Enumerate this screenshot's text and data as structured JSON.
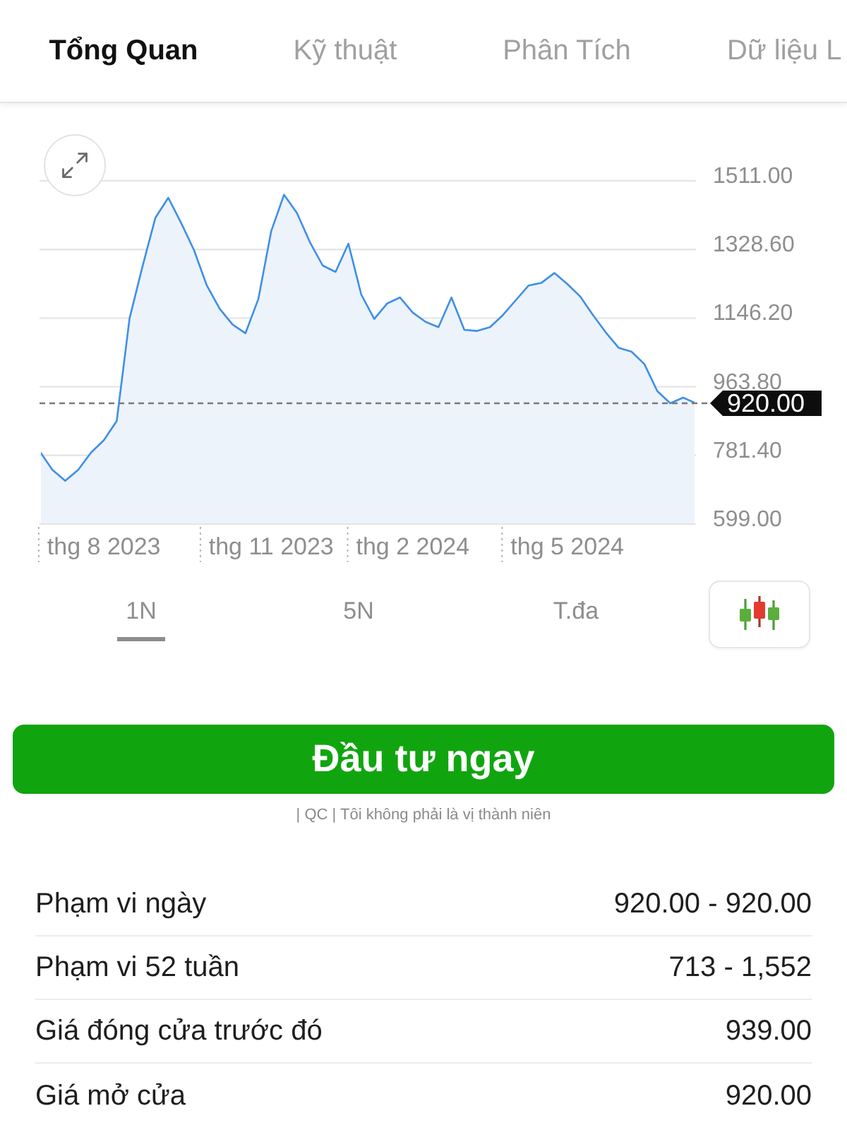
{
  "tabs": [
    {
      "label": "Tổng Quan",
      "selected": true
    },
    {
      "label": "Kỹ thuật",
      "selected": false
    },
    {
      "label": "Phân Tích",
      "selected": false
    },
    {
      "label": "Dữ liệu L",
      "selected": false
    }
  ],
  "chart": {
    "chart_data": {
      "type": "area",
      "grid": true,
      "categories": [
        null,
        null,
        null,
        null,
        null,
        "thg 8 2023",
        null,
        null,
        null,
        null,
        null,
        null,
        null,
        null,
        null,
        null,
        null,
        null,
        "thg 11 2023",
        null,
        null,
        null,
        null,
        null,
        null,
        null,
        null,
        null,
        null,
        "thg 2 2024",
        null,
        null,
        null,
        null,
        null,
        null,
        null,
        null,
        null,
        null,
        null,
        "thg 5 2024",
        null,
        null,
        null,
        null,
        null,
        null,
        null,
        null,
        null,
        null
      ],
      "ylim": [
        599,
        1511
      ],
      "yticks": [
        {
          "value": 599,
          "label": "599.00"
        },
        {
          "value": 781.4,
          "label": "781.40"
        },
        {
          "value": 963.8,
          "label": "963.80"
        },
        {
          "value": 1146.2,
          "label": "1146.20"
        },
        {
          "value": 1328.6,
          "label": "1328.60"
        },
        {
          "value": 1511,
          "label": "1511.00"
        }
      ],
      "series": [
        {
          "color": "#3f8fe6",
          "values": [
            793,
            743,
            714,
            743,
            789,
            822,
            873,
            1146,
            1283,
            1413,
            1466,
            1399,
            1327,
            1233,
            1171,
            1129,
            1106,
            1197,
            1377,
            1474,
            1425,
            1348,
            1286,
            1269,
            1344,
            1209,
            1144,
            1185,
            1201,
            1161,
            1136,
            1122,
            1201,
            1115,
            1112,
            1122,
            1154,
            1194,
            1233,
            1240,
            1266,
            1237,
            1204,
            1154,
            1108,
            1067,
            1057,
            1024,
            952,
            920,
            935,
            920
          ]
        }
      ],
      "ref_lines": [
        {
          "axis": "y",
          "value": 920,
          "label": "920.00"
        }
      ]
    }
  },
  "ranges": [
    {
      "label": "1N",
      "selected": true
    },
    {
      "label": "5N",
      "selected": false
    },
    {
      "label": "T.đa",
      "selected": false
    }
  ],
  "cta": {
    "label": "Đầu tư ngay",
    "note": "| QC | Tôi không phải là vị thành niên"
  },
  "stats": [
    {
      "label": "Phạm vi ngày",
      "value": "920.00 - 920.00"
    },
    {
      "label": "Phạm vi 52 tuần",
      "value": "713 - 1,552"
    },
    {
      "label": "Giá đóng cửa trước đó",
      "value": "939.00"
    },
    {
      "label": "Giá mở cửa",
      "value": "920.00"
    }
  ]
}
